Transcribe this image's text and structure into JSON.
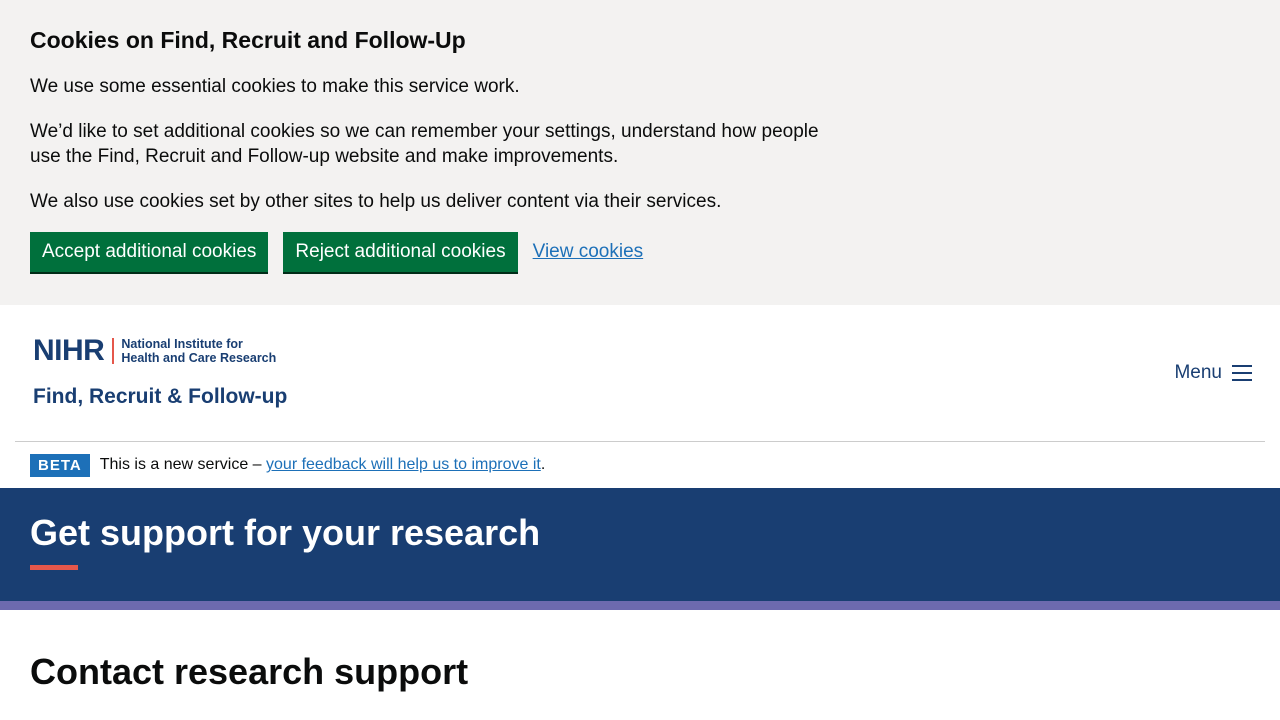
{
  "cookies": {
    "title": "Cookies on Find, Recruit and Follow-Up",
    "p1": "We use some essential cookies to make this service work.",
    "p2": "We’d like to set additional cookies so we can remember your settings, understand how people use the Find, Recruit and Follow-up website and make improvements.",
    "p3": "We also use cookies set by other sites to help us deliver content via their services.",
    "accept_label": "Accept additional cookies",
    "reject_label": "Reject additional cookies",
    "view_label": "View cookies"
  },
  "header": {
    "logo_nihr": "NIHR",
    "logo_line1": "National Institute for",
    "logo_line2": "Health and Care Research",
    "logo_subtitle": "Find, Recruit & Follow-up",
    "menu_label": "Menu"
  },
  "phase_banner": {
    "tag": "BETA",
    "text": "This is a new service – ",
    "link": "your feedback will help us to improve it",
    "suffix": "."
  },
  "hero": {
    "title": "Get support for your research"
  },
  "main": {
    "title": "Contact research support"
  },
  "colors": {
    "brand_blue": "#193e72",
    "button_green": "#00703c",
    "accent_red": "#e5574b",
    "stripe_purple": "#6d6aaf",
    "link_blue": "#1d70b8"
  }
}
